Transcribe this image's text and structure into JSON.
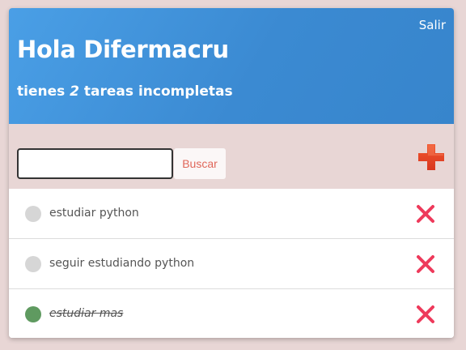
{
  "header": {
    "logout_label": "Salir",
    "greeting": "Hola Difermacru",
    "subtitle_prefix": "tienes ",
    "incomplete_count": "2",
    "subtitle_suffix": " tareas incompletas",
    "gradient_start": "#4a9fe6",
    "gradient_end": "#3785cc"
  },
  "search": {
    "value": "",
    "placeholder": "",
    "button_label": "Buscar",
    "add_icon": "plus-icon",
    "add_color": "#e8442a"
  },
  "tasks": [
    {
      "text": "estudiar python",
      "completed": false,
      "delete_icon": "close-icon"
    },
    {
      "text": "seguir estudiando python",
      "completed": false,
      "delete_icon": "close-icon"
    },
    {
      "text": "estudiar mas",
      "completed": true,
      "delete_icon": "close-icon"
    }
  ],
  "colors": {
    "background": "#e8d6d5",
    "delete": "#ee3a5b",
    "done_dot": "#5f9a60",
    "pending_dot": "#d6d6d6"
  }
}
